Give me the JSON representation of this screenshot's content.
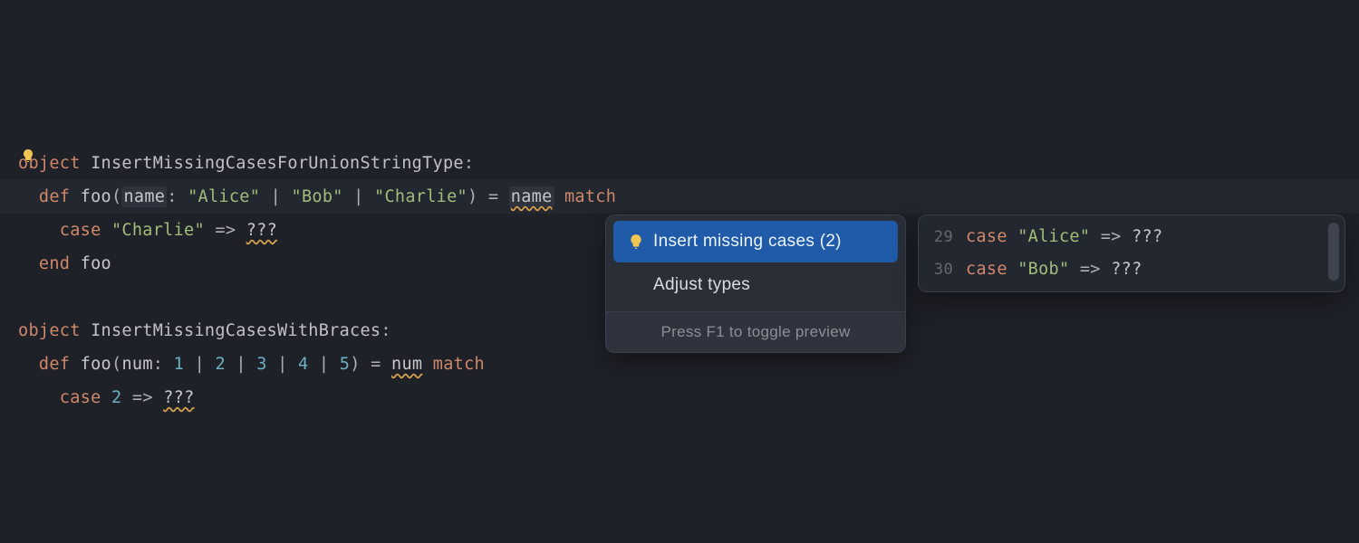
{
  "code": {
    "line1_object": "object",
    "line1_name": "InsertMissingCasesForUnionStringType",
    "line1_colon": ":",
    "line2_def": "def",
    "line2_fn": "foo",
    "line2_lparen": "(",
    "line2_param": "name",
    "line2_ptype_sep": ": ",
    "line2_str1": "\"Alice\"",
    "line2_pipe": " | ",
    "line2_str2": "\"Bob\"",
    "line2_str3": "\"Charlie\"",
    "line2_rparen_eq": ") = ",
    "line2_usage": "name",
    "line2_match": "match",
    "line3_case": "case",
    "line3_str": "\"Charlie\"",
    "line3_arrow": " => ",
    "line3_q": "???",
    "line4_end": "end",
    "line4_target": "foo",
    "line6_object": "object",
    "line6_name": "InsertMissingCasesWithBraces",
    "line6_colon": ":",
    "line7_def": "def",
    "line7_fn": "foo",
    "line7_lparen": "(",
    "line7_param": "num",
    "line7_ptype_sep": ": ",
    "line7_n1": "1",
    "line7_n2": "2",
    "line7_n3": "3",
    "line7_n4": "4",
    "line7_n5": "5",
    "line7_rparen_eq": ") = ",
    "line7_usage": "num",
    "line7_match": "match",
    "line8_case": "case",
    "line8_n": "2",
    "line8_arrow": " => ",
    "line8_q": "???"
  },
  "quickfix": {
    "item1": "Insert missing cases (2)",
    "item2": "Adjust types",
    "footer": "Press F1 to toggle preview"
  },
  "preview": {
    "l1_num": "29",
    "l1_case": "case",
    "l1_str": "\"Alice\"",
    "l1_arrow": " => ",
    "l1_q": "???",
    "l2_num": "30",
    "l2_case": "case",
    "l2_str": "\"Bob\"",
    "l2_arrow": " => ",
    "l2_q": "???"
  }
}
